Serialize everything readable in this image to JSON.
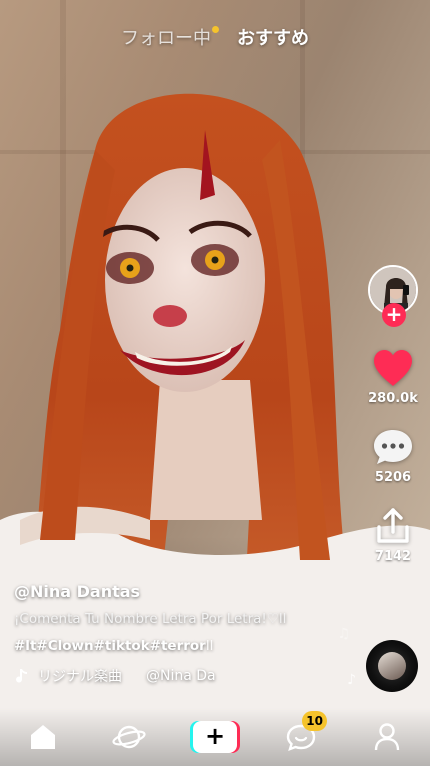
{
  "top_tabs": {
    "following": "フォロー中",
    "for_you": "おすすめ"
  },
  "rail": {
    "likes": "280.0k",
    "comments": "5206",
    "shares": "7142"
  },
  "caption": {
    "author": "@Nina Dantas",
    "description": "¡Comenta Tu Nombre Letra Por Letra!♡ll",
    "hashtags": "#lt#Clown#tiktok#terror",
    "hashtags_tail": "ll",
    "sound_name": "リジナル楽曲",
    "sound_author": "@Nina Da"
  },
  "nav": {
    "inbox_badge": "10"
  },
  "colors": {
    "accent_red": "#fe2c55",
    "accent_cyan": "#25f4ee",
    "badge_yellow": "#f5c32c"
  },
  "icons": [
    "home-icon",
    "discover-icon",
    "create-icon",
    "inbox-icon",
    "profile-icon",
    "heart-icon",
    "comment-icon",
    "share-icon",
    "music-note-icon"
  ]
}
